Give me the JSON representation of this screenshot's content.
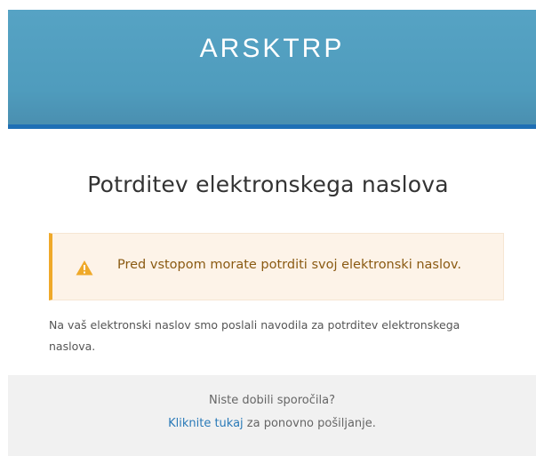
{
  "header": {
    "brand": "ARSKTRP"
  },
  "main": {
    "title": "Potrditev elektronskega naslova",
    "alert": {
      "icon": "warning-icon",
      "message": "Pred vstopom morate potrditi svoj elektronski naslov."
    },
    "info_text": "Na vaš elektronski naslov smo poslali navodila za potrditev elektronskega naslova."
  },
  "footer": {
    "question": "Niste dobili sporočila?",
    "resend_link": "Kliknite tukaj",
    "resend_suffix": " za ponovno pošiljanje."
  },
  "colors": {
    "header_bg": "#4f9cbd",
    "header_bar": "#1e6fb5",
    "alert_bg": "#fdf3e8",
    "alert_border": "#efa929",
    "link": "#2a7ab8"
  }
}
